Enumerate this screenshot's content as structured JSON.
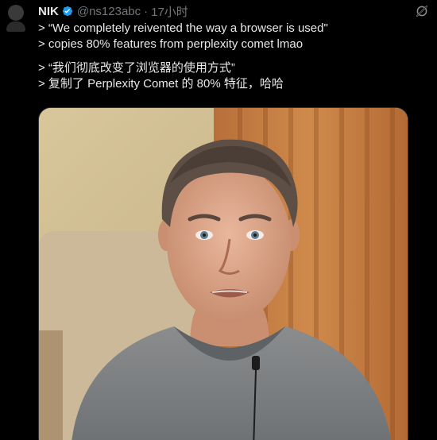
{
  "author": {
    "name": "NIK",
    "handle": "@ns123abc",
    "separator": "·",
    "time": "17小时"
  },
  "icons": {
    "verified": "verified-badge-icon",
    "grok": "grok-icon",
    "avatar": "default-avatar-icon"
  },
  "colors": {
    "background": "#000000",
    "text": "#e7e9ea",
    "muted": "#71767b",
    "verified": "#1d9bf0"
  },
  "post": {
    "lines": [
      "> “We completely reivented the way a browser is used\"",
      "> copies 80% features from perplexity comet lmao"
    ],
    "translation_lines": [
      "> “我们彻底改变了浏览器的使用方式”",
      "> 复制了 Perplexity Comet 的 80% 特征，哈哈"
    ]
  }
}
